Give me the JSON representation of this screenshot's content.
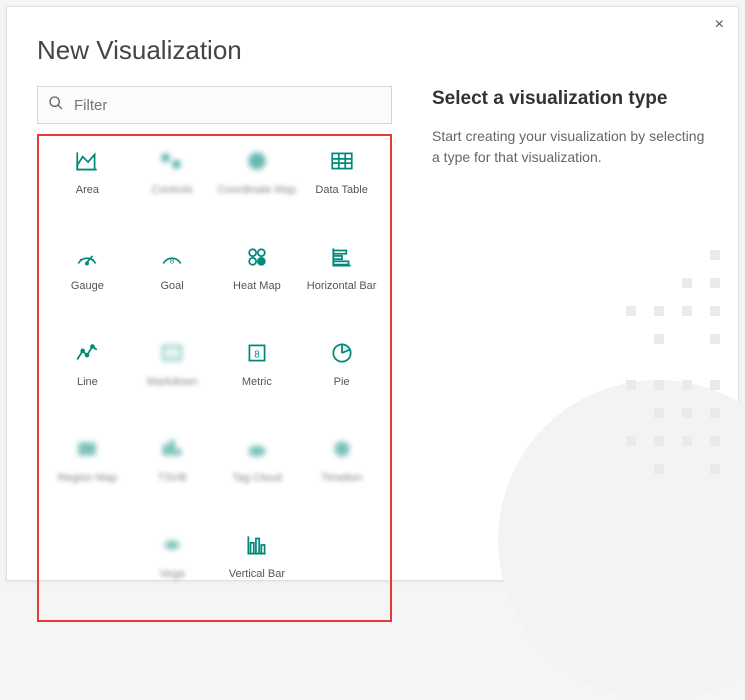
{
  "modal": {
    "title": "New Visualization",
    "close": "×",
    "search_placeholder": "Filter",
    "right_heading": "Select a visualization type",
    "right_body": "Start creating your visualization by selecting a type for that visualization."
  },
  "vis_types": {
    "area": "Area",
    "controls": "Controls",
    "coordmap": "Coordinate Map",
    "datatable": "Data Table",
    "gauge": "Gauge",
    "goal": "Goal",
    "heatmap": "Heat Map",
    "horizbar": "Horizontal Bar",
    "line": "Line",
    "markdown": "Markdown",
    "metric": "Metric",
    "pie": "Pie",
    "regionmap": "Region Map",
    "tsvb": "TSVB",
    "tagcloud": "Tag Cloud",
    "timelion": "Timelion",
    "vega": "Vega",
    "vertbar": "Vertical Bar"
  }
}
